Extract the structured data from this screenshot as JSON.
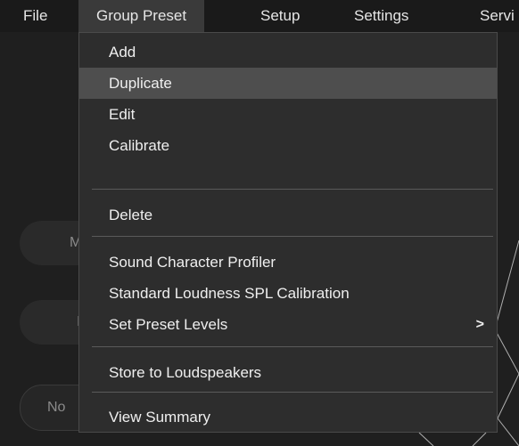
{
  "menubar": {
    "items": [
      "File",
      "Group Preset",
      "Setup",
      "Settings",
      "Servi"
    ]
  },
  "background": {
    "pill_1": "M",
    "pill_2": "I",
    "pill_3": "No"
  },
  "dropdown": {
    "items": [
      "Add",
      "Duplicate",
      "Edit",
      "Calibrate",
      "Delete",
      "Sound Character Profiler",
      "Standard Loudness SPL Calibration",
      "Set Preset Levels",
      "Store to Loudspeakers",
      "View Summary"
    ],
    "highlighted_item": "Duplicate",
    "submenu_arrow": ">"
  },
  "colors": {
    "menu_bg": "#2d2d2d",
    "highlight_bg": "#4e4e4e",
    "menubar_active_bg": "#3a3a3a",
    "text": "#efefef"
  }
}
